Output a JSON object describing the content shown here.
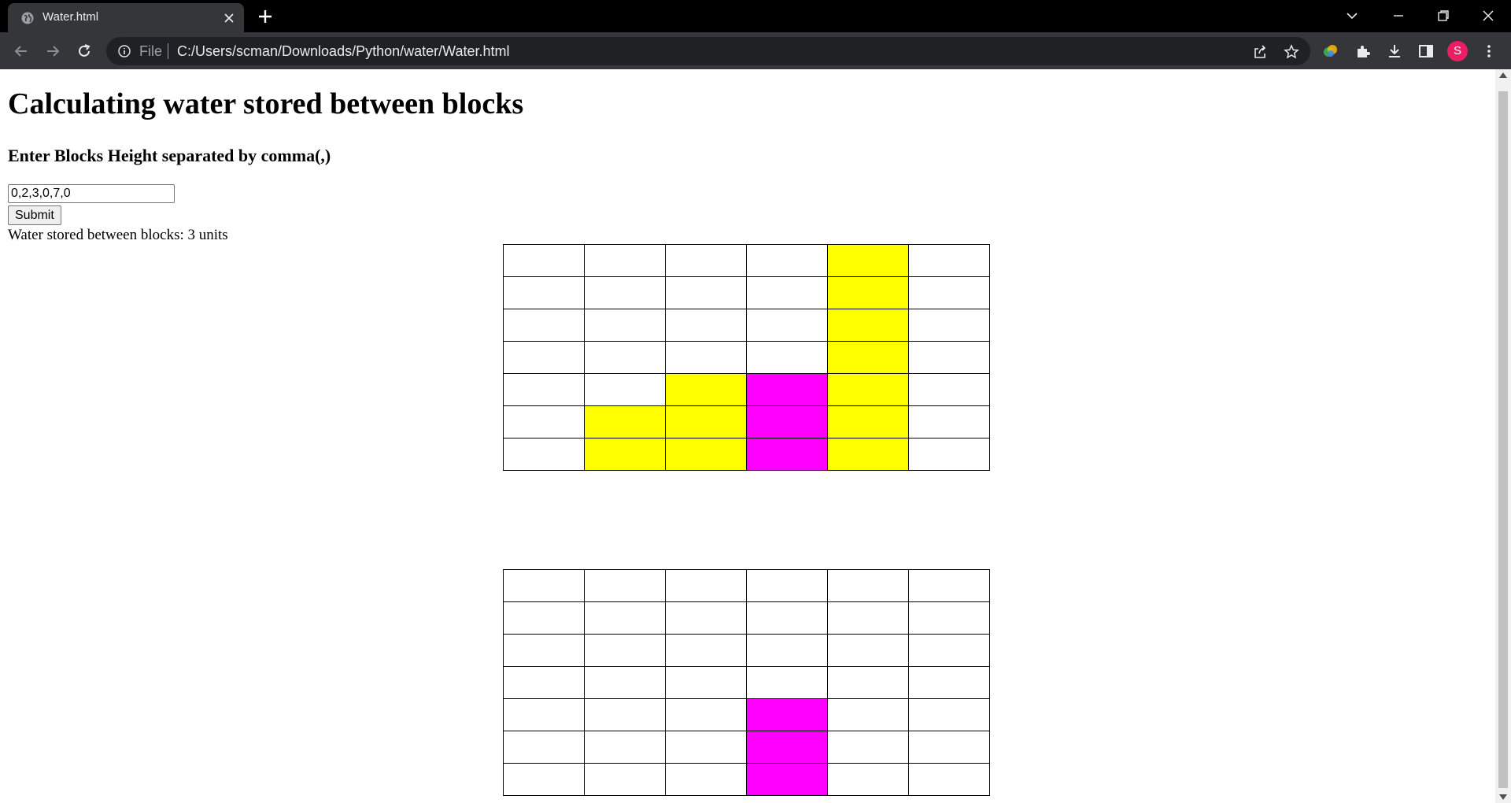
{
  "browser": {
    "tab_title": "Water.html",
    "url_scheme_label": "File",
    "url": "C:/Users/scman/Downloads/Python/water/Water.html",
    "profile_initial": "S"
  },
  "page": {
    "title": "Calculating water stored between blocks",
    "prompt": "Enter Blocks Height separated by comma(,)",
    "input_value": "0,2,3,0,7,0",
    "submit_label": "Submit",
    "result_text": "Water stored between blocks: 3 units"
  },
  "colors": {
    "block": "#ffff00",
    "water": "#ff00ff",
    "empty": "#ffffff"
  },
  "grids": {
    "rows": 7,
    "heights": [
      0,
      2,
      3,
      0,
      7,
      0
    ],
    "water": [
      0,
      0,
      0,
      3,
      0,
      0
    ],
    "combined_show_blocks": true
  }
}
